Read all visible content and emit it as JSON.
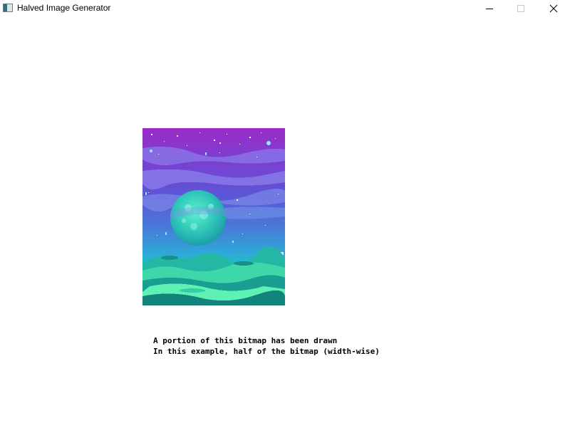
{
  "window": {
    "title": "Halved Image Generator",
    "controls": {
      "minimize_icon": "minimize-icon",
      "maximize_icon": "maximize-icon",
      "close_icon": "close-icon"
    }
  },
  "bitmap": {
    "description_icon": "space-planet-bitmap",
    "colors": {
      "sky_top": "#9b2fc9",
      "sky_mid": "#5b57d8",
      "sky_low": "#3aa0d6",
      "horizon": "#1fc6c9",
      "clouds": "#8a78e8",
      "planet": "#3fd6c0",
      "ground_dark": "#0f8f86",
      "ground_light": "#6df0b8"
    }
  },
  "caption": {
    "line1": "A portion of this bitmap has been drawn",
    "line2": "In this example, half of the bitmap (width-wise)"
  }
}
